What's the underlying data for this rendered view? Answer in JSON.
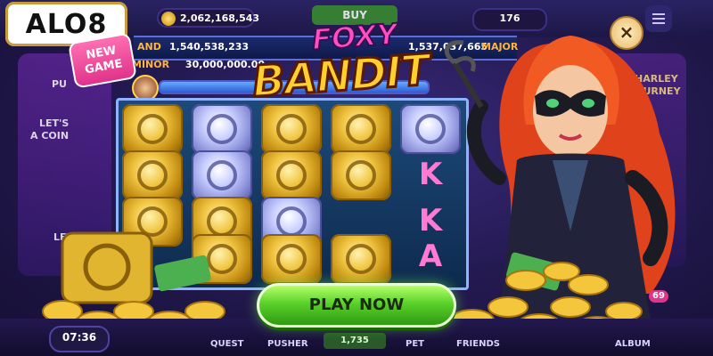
{
  "brand": {
    "logo_text": "ALO8"
  },
  "top_bar": {
    "coins": "2,062,168,543",
    "buy_label": "BUY",
    "level": "176",
    "close_symbol": "×"
  },
  "jackpot": {
    "left_label": "AND",
    "left_value": "1,540,538,233",
    "right_value": "1,537,037,665",
    "right_label": "MAJOR",
    "minor_label": "MINOR",
    "minor_value": "30,000,000.00"
  },
  "new_badge": {
    "line1": "NEW",
    "line2": "GAME"
  },
  "game_title": {
    "line1": "FOXY",
    "line2": "BANDIT"
  },
  "reels": {
    "letters": [
      "K",
      "K",
      "A"
    ]
  },
  "play_button": {
    "label": "PLAY NOW"
  },
  "side_panels": {
    "left_lines": [
      "PU",
      "LET'S",
      "A COIN",
      "LET"
    ],
    "right_lines": [
      "HARLEY",
      "JOURNEY"
    ]
  },
  "bottom_nav": {
    "timer": "07:36",
    "quest": "QUEST",
    "pusher": "PUSHER",
    "pusher_count": "1,735",
    "pet": "PET",
    "friends": "FRIENDS",
    "album": "ALBUM",
    "album_badge": "69"
  },
  "colors": {
    "background": "#241a52",
    "gold": "#ffcf2e",
    "pink": "#ff4fc2",
    "play_green": "#5ad12b"
  }
}
